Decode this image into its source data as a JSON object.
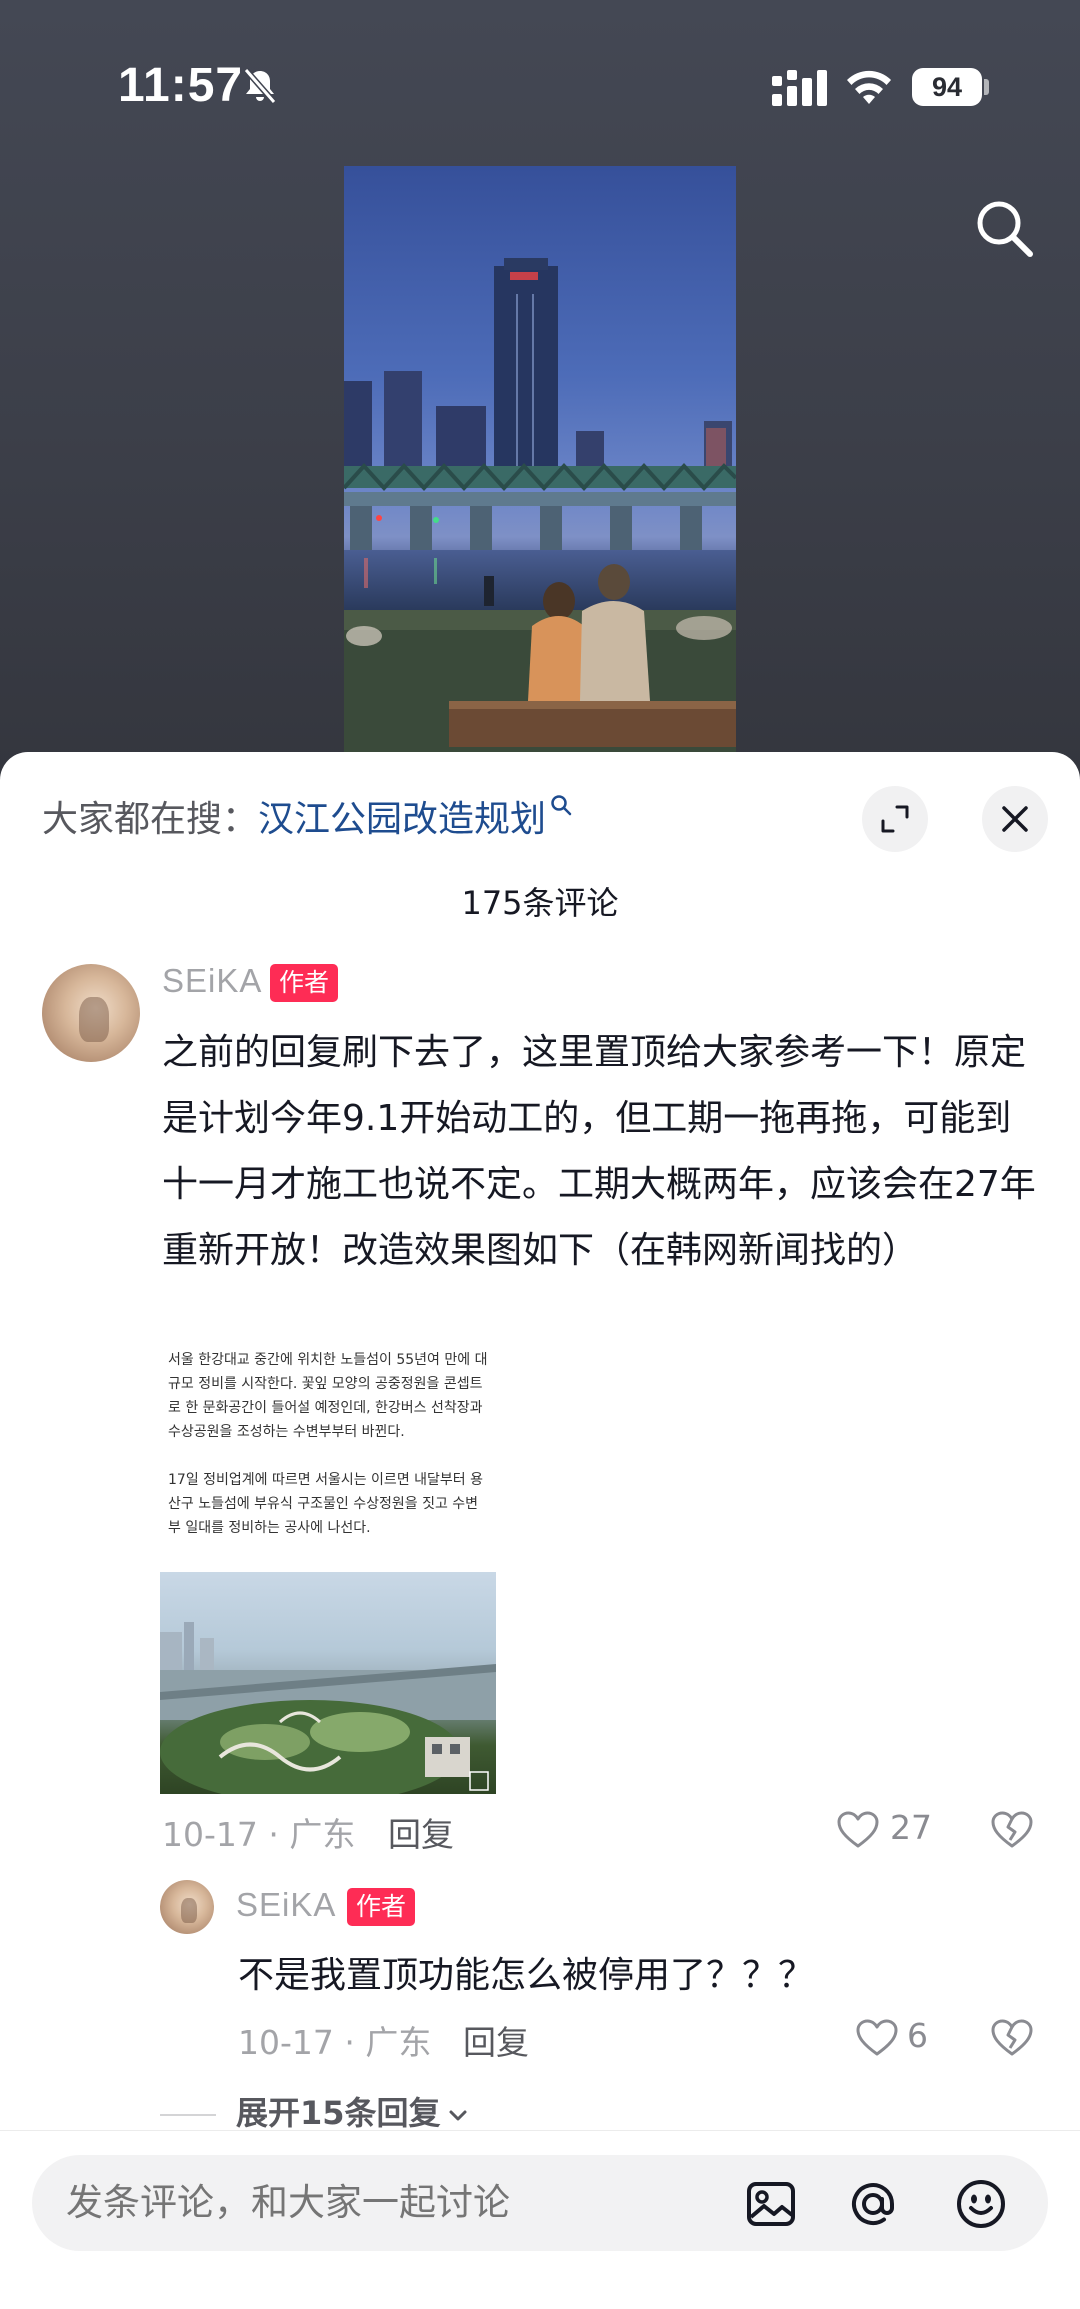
{
  "status_bar": {
    "time": "11:57",
    "battery": "94"
  },
  "icons": {
    "silent": "bell-slash-icon",
    "signal": "cellular-signal-icon",
    "wifi": "wifi-icon",
    "search": "search-icon",
    "expand": "expand-icon",
    "close": "close-icon",
    "like": "heart-icon",
    "dislike": "broken-heart-icon",
    "image": "image-icon",
    "mention": "at-icon",
    "emoji": "emoji-icon"
  },
  "search_hint": {
    "prefix": "大家都在搜：",
    "term": "汉江公园改造规划"
  },
  "comments_header": {
    "count_text": "175条评论"
  },
  "comment": {
    "username": "SEiKA",
    "author_tag": "作者",
    "text": "之前的回复刷下去了，这里置顶给大家参考一下！原定是计划今年9.1开始动工的，但工期一拖再拖，可能到十一月才施工也说不定。工期大概两年，应该会在27年重新开放！改造效果图如下（在韩网新闻找的）",
    "article_p1": "서울 한강대교 중간에 위치한 노들섬이 55년여 만에 대규모 정비를 시작한다. 꽃잎 모양의 공중정원을 콘셉트로 한 문화공간이 들어설 예정인데, 한강버스 선착장과 수상공원을 조성하는 수변부부터 바뀐다.",
    "article_p2": "17일 정비업계에 따르면 서울시는 이르면 내달부터 용산구 노들섬에 부유식 구조물인 수상정원을 짓고 수변부 일대를 정비하는 공사에 나선다.",
    "meta": "10-17 · 广东",
    "reply_label": "回复",
    "likes": "27"
  },
  "reply": {
    "username": "SEiKA",
    "author_tag": "作者",
    "text": "不是我置顶功能怎么被停用了？？？",
    "meta": "10-17 · 广东",
    "reply_label": "回复",
    "likes": "6"
  },
  "expand_replies": {
    "label": "展开15条回复"
  },
  "input_bar": {
    "placeholder": "发条评论，和大家一起讨论"
  },
  "colors": {
    "accent_red": "#fe2c55",
    "link_blue": "#1e4c8f",
    "muted_gray": "#a3a4a8"
  }
}
